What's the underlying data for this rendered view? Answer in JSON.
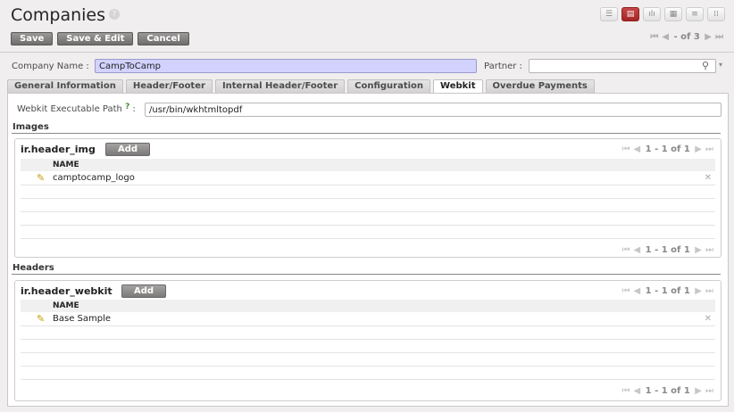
{
  "header": {
    "title": "Companies",
    "help": "?",
    "view_icons": [
      "list-icon",
      "form-icon",
      "graph-icon",
      "calendar-icon",
      "gantt-icon",
      "kanban-icon"
    ],
    "accent": "#a52424"
  },
  "actions": {
    "save": "Save",
    "save_edit": "Save & Edit",
    "cancel": "Cancel"
  },
  "pager": {
    "first": "⏮",
    "prev": "◀",
    "text": "- of 3",
    "next": "▶",
    "last": "⏭"
  },
  "form": {
    "company_label": "Company Name :",
    "company_value": "CampToCamp",
    "partner_label": "Partner :",
    "partner_value": ""
  },
  "tabs": [
    {
      "label": "General Information",
      "active": false
    },
    {
      "label": "Header/Footer",
      "active": false
    },
    {
      "label": "Internal Header/Footer",
      "active": false
    },
    {
      "label": "Configuration",
      "active": false
    },
    {
      "label": "Webkit",
      "active": true
    },
    {
      "label": "Overdue Payments",
      "active": false
    }
  ],
  "webkit": {
    "path_label": "Webkit Executable Path",
    "path_help": "?",
    "path_colon": ":",
    "path_value": "/usr/bin/wkhtmltopdf"
  },
  "images": {
    "section": "Images",
    "field": "ir.header_img",
    "add": "Add",
    "pager": "1 - 1 of 1",
    "column": "NAME",
    "rows": [
      "camptocamp_logo"
    ]
  },
  "headers": {
    "section": "Headers",
    "field": "ir.header_webkit",
    "add": "Add",
    "pager": "1 - 1 of 1",
    "column": "NAME",
    "rows": [
      "Base Sample"
    ]
  }
}
